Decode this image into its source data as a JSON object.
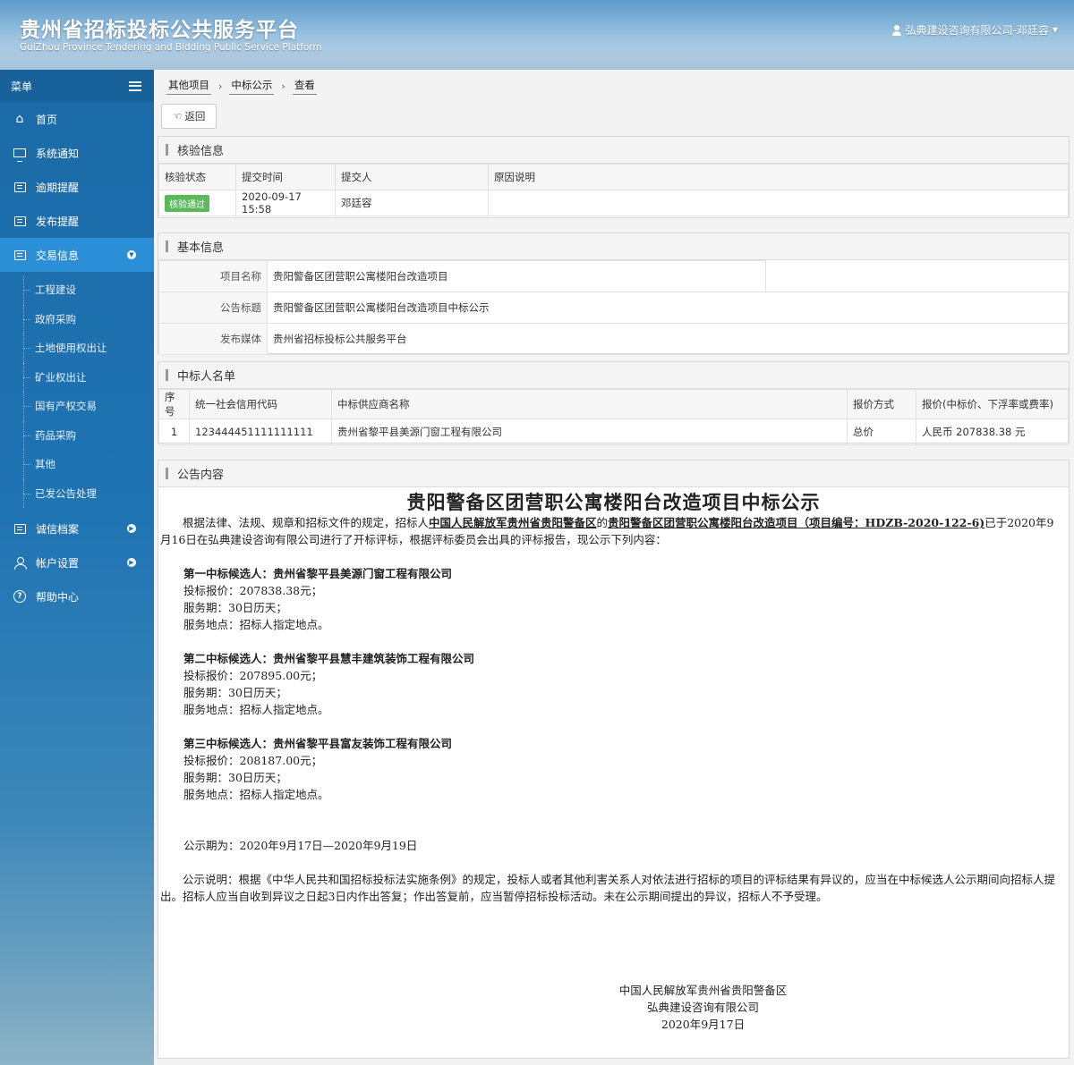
{
  "header": {
    "title": "贵州省招标投标公共服务平台",
    "subtitle": "GuiZhou Province Tendering and Bidding Public Service Platform",
    "user": "弘典建设咨询有限公司-邓廷容"
  },
  "sidebar": {
    "menu_label": "菜单",
    "items": [
      {
        "label": "首页",
        "icon": "home-icon"
      },
      {
        "label": "系统通知",
        "icon": "monitor-icon"
      },
      {
        "label": "逾期提醒",
        "icon": "list-icon"
      },
      {
        "label": "发布提醒",
        "icon": "list-icon"
      },
      {
        "label": "交易信息",
        "icon": "list-icon"
      },
      {
        "label": "诚信档案",
        "icon": "list-icon"
      },
      {
        "label": "帐户设置",
        "icon": "user-icon"
      },
      {
        "label": "帮助中心",
        "icon": "help-icon"
      }
    ],
    "sub_items": [
      "工程建设",
      "政府采购",
      "土地使用权出让",
      "矿业权出让",
      "国有产权交易",
      "药品采购",
      "其他",
      "已发公告处理"
    ]
  },
  "breadcrumb": [
    "其他项目",
    "中标公示",
    "查看"
  ],
  "back_label": "返回",
  "verify": {
    "title": "核验信息",
    "headers": [
      "核验状态",
      "提交时间",
      "提交人",
      "原因说明"
    ],
    "status": "核验通过",
    "time": "2020-09-17 15:58",
    "submitter": "邓廷容",
    "reason": ""
  },
  "basic": {
    "title": "基本信息",
    "rows": [
      {
        "label": "项目名称",
        "value": "贵阳警备区团营职公寓楼阳台改造项目"
      },
      {
        "label": "公告标题",
        "value": "贵阳警备区团营职公寓楼阳台改造项目中标公示"
      },
      {
        "label": "发布媒体",
        "value": "贵州省招标投标公共服务平台"
      }
    ]
  },
  "winners": {
    "title": "中标人名单",
    "headers": [
      "序号",
      "统一社会信用代码",
      "中标供应商名称",
      "报价方式",
      "报价(中标价、下浮率或费率)"
    ],
    "rows": [
      {
        "no": "1",
        "code": "123444451111111111",
        "name": "贵州省黎平县美源门窗工程有限公司",
        "method": "总价",
        "price": "人民币 207838.38 元"
      }
    ]
  },
  "notice": {
    "section_title": "公告内容",
    "title": "贵阳警备区团营职公寓楼阳台改造项目中标公示",
    "intro_a": "根据法律、法规、规章和招标文件的规定，招标人",
    "intro_tenderer": "中国人民解放军贵州省贵阳警备区",
    "intro_b": "的",
    "intro_project": "贵阳警备区团营职公寓楼阳台改造项目（项目编号：HDZB-2020-122-6)",
    "intro_c": "已于2020年9月16日在弘典建设咨询有限公司进行了开标评标，根据评标委员会出具的评标报告，现公示下列内容：",
    "candidates": [
      {
        "title": "第一中标候选人：贵州省黎平县美源门窗工程有限公司",
        "price": "投标报价：207838.38元；",
        "period": "服务期：30日历天；",
        "place": "服务地点：招标人指定地点。"
      },
      {
        "title": "第二中标候选人：贵州省黎平县慧丰建筑装饰工程有限公司",
        "price": "投标报价：207895.00元；",
        "period": "服务期：30日历天；",
        "place": "服务地点：招标人指定地点。"
      },
      {
        "title": "第三中标候选人：贵州省黎平县富友装饰工程有限公司",
        "price": "投标报价：208187.00元；",
        "period": "服务期：30日历天；",
        "place": "服务地点：招标人指定地点。"
      }
    ],
    "period": "公示期为：2020年9月17日—2020年9月19日",
    "explain": "公示说明：根据《中华人民共和国招标投标法实施条例》的规定，投标人或者其他利害关系人对依法进行招标的项目的评标结果有异议的，应当在中标候选人公示期间向招标人提出。招标人应当自收到异议之日起3日内作出答复；作出答复前，应当暂停招标投标活动。未在公示期间提出的异议，招标人不予受理。",
    "sign_1": "中国人民解放军贵州省贵阳警备区",
    "sign_2": "弘典建设咨询有限公司",
    "sign_date": "2020年9月17日"
  }
}
